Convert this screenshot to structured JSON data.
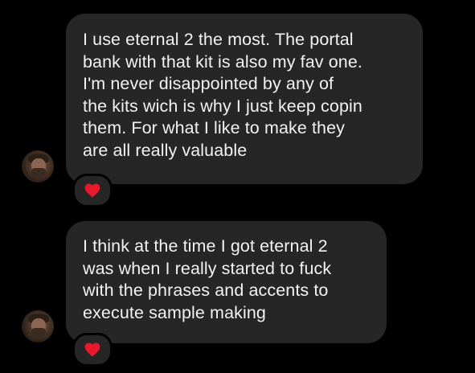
{
  "messages": [
    {
      "text": "I use eternal 2 the most. The portal\nbank with that kit is also my fav one.\nI'm never disappointed by any of\nthe kits wich is why I just keep copin\nthem. For what I like to make they\nare all really valuable",
      "reaction": "heart-icon"
    },
    {
      "text": "I think at the time I got eternal 2\nwas when I really started to fuck\nwith the phrases and accents to\nexecute sample making",
      "reaction": "heart-icon"
    }
  ],
  "colors": {
    "background": "#000000",
    "bubble": "#262626",
    "text": "#f2f2f2",
    "heart": "#e8192c"
  }
}
